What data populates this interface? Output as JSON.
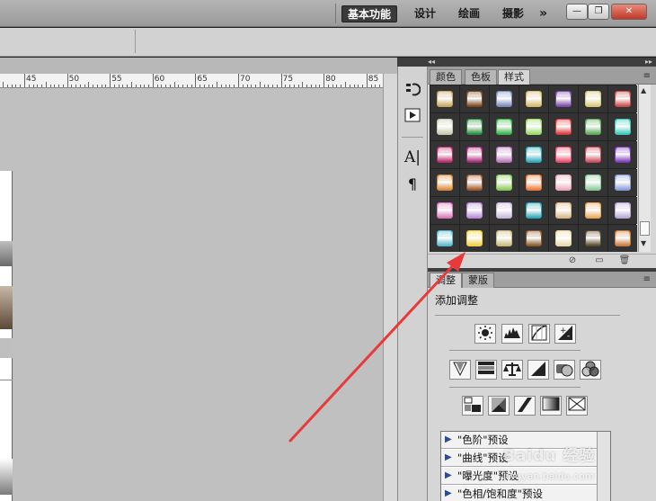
{
  "topbar": {
    "workspaces": [
      "基本功能",
      "设计",
      "绘画",
      "摄影"
    ],
    "more": "»",
    "window_buttons": {
      "minimize": "—",
      "restore": "❐",
      "close": "✕"
    }
  },
  "ruler": {
    "labels": [
      "45",
      "50",
      "55",
      "60",
      "65",
      "70",
      "75",
      "80",
      "85"
    ]
  },
  "panel_top": {
    "collapse_left": "◂◂",
    "collapse_right": "▸▸",
    "tabs": [
      "颜色",
      "色板",
      "样式"
    ],
    "active_tab": "样式"
  },
  "styles_footer": {
    "icons": [
      "no-style-icon",
      "new-style-icon",
      "delete-style-icon"
    ]
  },
  "panel_bottom": {
    "tabs": [
      "调整",
      "蒙版"
    ],
    "active_tab": "调整",
    "title": "添加调整"
  },
  "presets": [
    "\"色阶\"预设",
    "\"曲线\"预设",
    "\"曝光度\"预设",
    "\"色相/饱和度\"预设"
  ],
  "watermark": {
    "text": "Baidu 经验",
    "url": "jingyan.baidu.com"
  },
  "colors": {
    "arrow": "#e83a3a",
    "active_workspace": "#3a3a3a"
  },
  "swatches": [
    [
      "#c9a65e",
      "#7a4a1e",
      "#7a8ab8",
      "#d8b86a",
      "#7a4aa8",
      "#d8c87a",
      "#c84a4a"
    ],
    [
      "#c8c8b0",
      "#2a8a3a",
      "#3ab04a",
      "#9ad86a",
      "#d83a3a",
      "#58a858",
      "#38c8b8"
    ],
    [
      "#b8286a",
      "#a82878",
      "#b878b8",
      "#2aa8b8",
      "#e84a6a",
      "#c84a5a",
      "#7a3ab8"
    ],
    [
      "#d8883a",
      "#9a5828",
      "#88c858",
      "#e87a3a",
      "#e8a8b8",
      "#8ac898",
      "#8a9ad8"
    ],
    [
      "#d878b8",
      "#b88ad8",
      "#c8b8d8",
      "#2aa8b8",
      "#d8b888",
      "#e8a85a",
      "#b8a8d8"
    ],
    [
      "#5ab8c8",
      "#f0d040",
      "#c8b87a",
      "#8a5a2a",
      "#e8d8a8",
      "#5a4a2a",
      "#c87a3a"
    ]
  ]
}
